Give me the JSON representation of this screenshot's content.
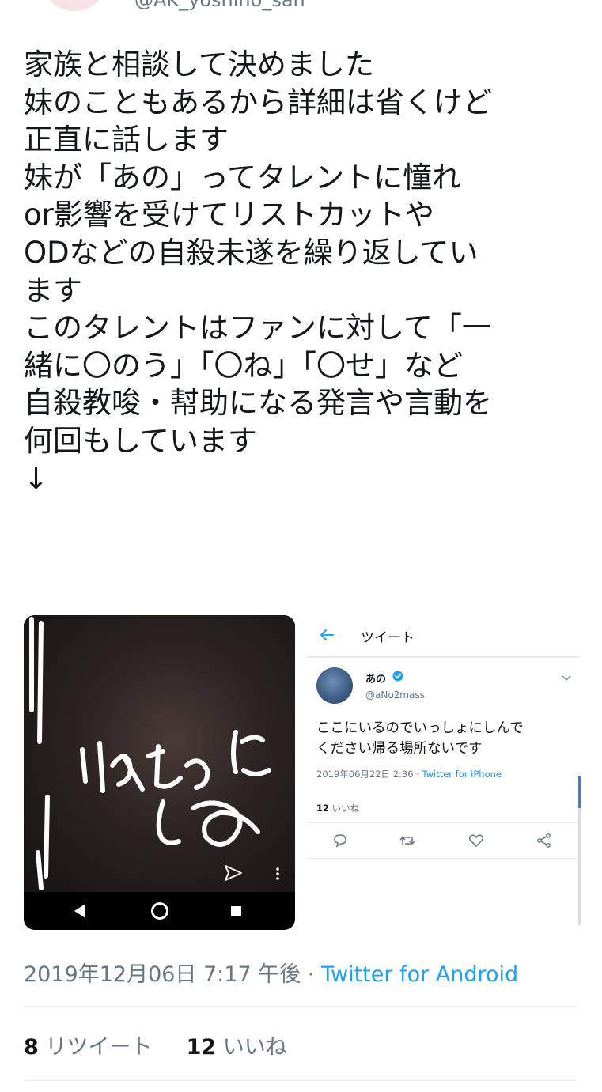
{
  "header": {
    "handle_partial": "@AK_yoshino_san"
  },
  "tweet": {
    "lines": [
      "家族と相談して決めました",
      "妹のこともあるから詳細は省くけど",
      "正直に話します",
      "妹が「あの」ってタレントに憧れ",
      "or影響を受けてリストカットや",
      "ODなどの自殺未遂を繰り返してい",
      "ます",
      "このタレントはファンに対して「一",
      "緒に〇のう」「〇ね」「〇せ」など",
      "自殺教唆・幇助になる発言や言動を",
      "何回もしています",
      "↓"
    ],
    "timestamp": "2019年12月06日 7:17 午後 · ",
    "source": "Twitter for Android",
    "retweet_count": "8",
    "retweet_label": "リツイート",
    "like_count": "12",
    "like_label": "いいね"
  },
  "embedded_screenshot": {
    "title": "ツイート",
    "name": "あの",
    "handle": "@aNo2mass",
    "text_lines": [
      "ここにいるのでいっしょにしんで",
      "ください帰る場所ないです"
    ],
    "date": "2019年06月22日 2:36 · ",
    "source": "Twitter for iPhone",
    "likes_count": "12",
    "likes_label": "いいね"
  },
  "colors": {
    "link": "#1da1f2",
    "muted": "#657786",
    "text": "#14171a"
  }
}
